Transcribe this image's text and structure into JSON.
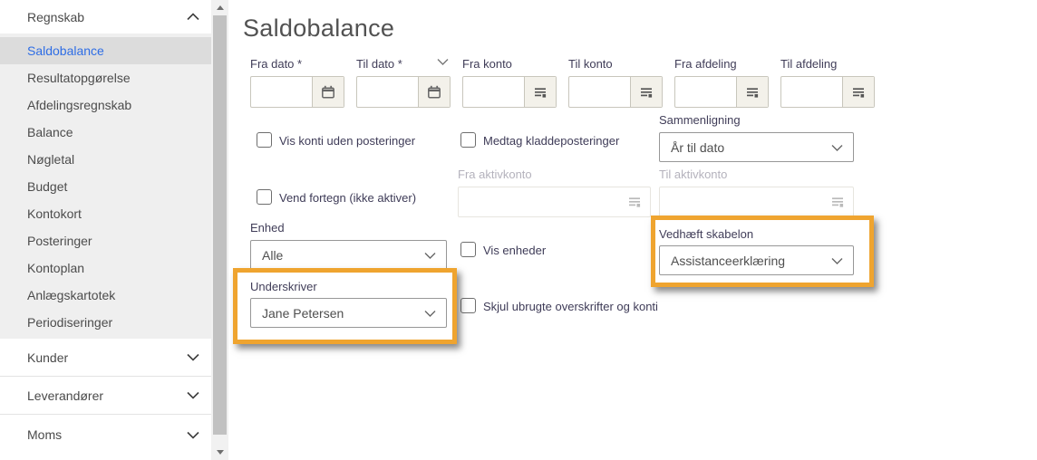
{
  "sidebar": {
    "regnskab": {
      "label": "Regnskab"
    },
    "regnskab_items": [
      {
        "label": "Saldobalance",
        "selected": true
      },
      {
        "label": "Resultatopgørelse"
      },
      {
        "label": "Afdelingsregnskab"
      },
      {
        "label": "Balance"
      },
      {
        "label": "Nøgletal"
      },
      {
        "label": "Budget"
      },
      {
        "label": "Kontokort"
      },
      {
        "label": "Posteringer"
      },
      {
        "label": "Kontoplan"
      },
      {
        "label": "Anlægskartotek"
      },
      {
        "label": "Periodiseringer"
      }
    ],
    "collapsed_groups": [
      {
        "label": "Kunder"
      },
      {
        "label": "Leverandører"
      },
      {
        "label": "Moms"
      }
    ]
  },
  "main": {
    "title": "Saldobalance",
    "filter_fields": [
      {
        "label": "Fra dato *",
        "type": "date",
        "value": ""
      },
      {
        "label": "Til dato *",
        "type": "date",
        "value": "",
        "has_preset_chevron": true
      },
      {
        "label": "Fra konto",
        "type": "lookup",
        "value": ""
      },
      {
        "label": "Til konto",
        "type": "lookup",
        "value": ""
      },
      {
        "label": "Fra afdeling",
        "type": "lookup",
        "value": ""
      },
      {
        "label": "Til afdeling",
        "type": "lookup",
        "value": ""
      }
    ],
    "checkboxes": [
      {
        "label": "Vis konti uden posteringer",
        "checked": false
      },
      {
        "label": "Medtag kladdeposteringer",
        "checked": false
      },
      {
        "label": "Vend fortegn (ikke aktiver)",
        "checked": false
      },
      {
        "label": "Vis enheder",
        "checked": false
      },
      {
        "label": "Skjul ubrugte overskrifter og konti",
        "checked": false
      }
    ],
    "sammenligning": {
      "label": "Sammenligning",
      "value": "År til dato"
    },
    "fra_aktivkonto": {
      "label": "Fra aktivkonto",
      "value": "",
      "disabled": true
    },
    "til_aktivkonto": {
      "label": "Til aktivkonto",
      "value": "",
      "disabled": true
    },
    "enhed": {
      "label": "Enhed",
      "value": "Alle"
    },
    "underskriver": {
      "label": "Underskriver",
      "value": "Jane Petersen",
      "highlighted": true
    },
    "vedhaeft_skabelon": {
      "label": "Vedhæft skabelon",
      "value": "Assistanceerklæring",
      "highlighted": true
    }
  },
  "colors": {
    "highlight_border": "#efa42f",
    "selected_item_text": "#2e6de5",
    "selected_item_bg": "#dcdcdc",
    "sidebar_submenu_bg": "#efefef",
    "field_label": "#403d58"
  }
}
